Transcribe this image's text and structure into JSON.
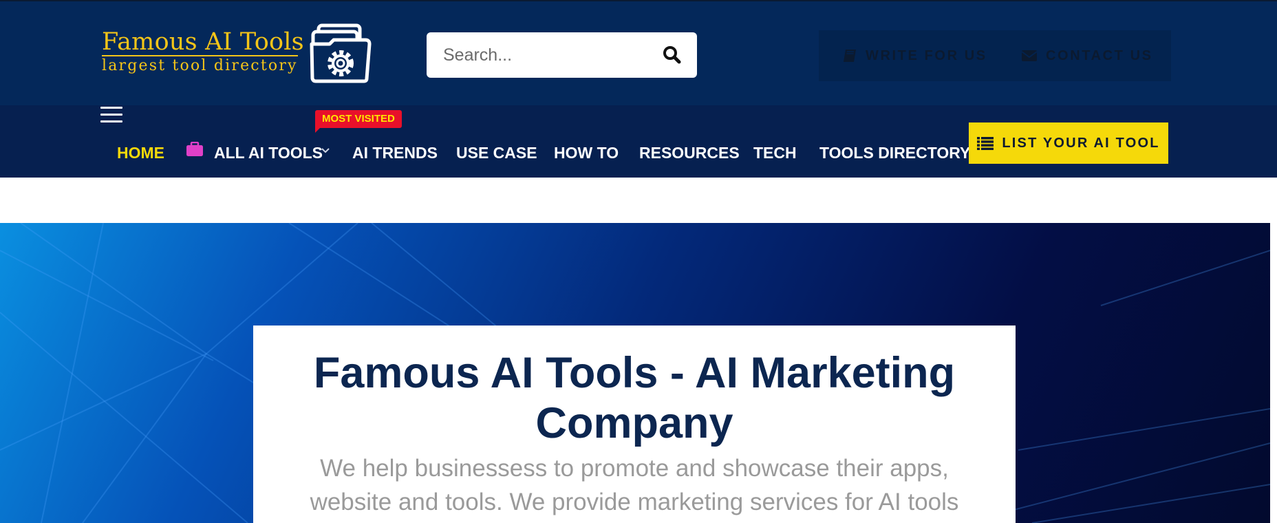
{
  "header": {
    "logo_title": "Famous AI Tools",
    "logo_subtitle": "largest tool directory",
    "search_placeholder": "Search...",
    "write_for_us": "WRITE FOR US",
    "contact_us": "CONTACT US"
  },
  "nav": {
    "items": [
      {
        "label": "HOME"
      },
      {
        "label": "ALL AI TOOLS"
      },
      {
        "label": "AI TRENDS"
      },
      {
        "label": "USE CASE"
      },
      {
        "label": "HOW TO"
      },
      {
        "label": "RESOURCES"
      },
      {
        "label": "TECH"
      },
      {
        "label": "TOOLS DIRECTORY"
      }
    ],
    "badge": "MOST VISITED",
    "cta": "LIST YOUR AI TOOL"
  },
  "hero": {
    "title_line1": "Famous AI Tools - AI Marketing",
    "title_line2": "Company",
    "subtitle_line1": "We help businessess to promote and showcase their apps,",
    "subtitle_line2": "website and tools. We provide marketing services for AI tools"
  },
  "colors": {
    "header_bg": "#04285a",
    "nav_bg": "#062050",
    "accent_yellow": "#f5d90a",
    "logo_gold": "#f5c518",
    "badge_red": "#e8102a",
    "title_navy": "#0c2650",
    "briefcase_pink": "#e040c8"
  },
  "icons": [
    "folder-gear-logo-icon",
    "search-icon",
    "book-icon",
    "envelope-icon",
    "hamburger-icon",
    "briefcase-icon",
    "chevron-down-icon",
    "list-icon"
  ]
}
